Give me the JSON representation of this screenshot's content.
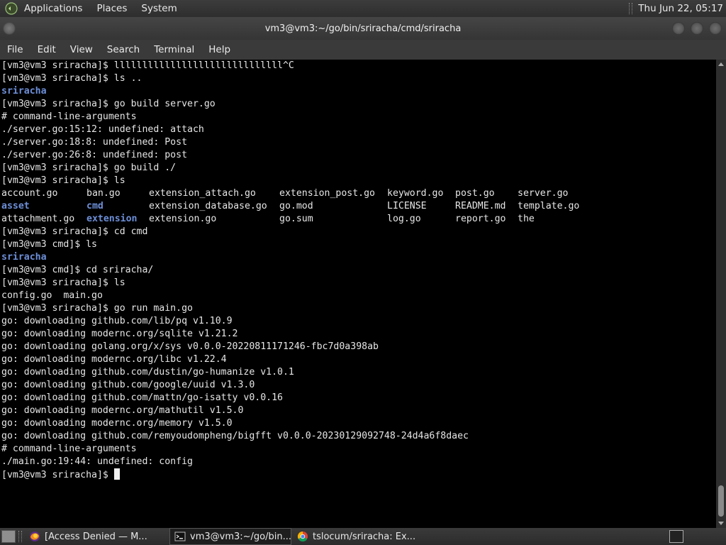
{
  "top_panel": {
    "menus": [
      "Applications",
      "Places",
      "System"
    ],
    "clock": "Thu Jun 22, 05:17"
  },
  "window": {
    "title": "vm3@vm3:~/go/bin/sriracha/cmd/sriracha"
  },
  "menubar": {
    "items": [
      "File",
      "Edit",
      "View",
      "Search",
      "Terminal",
      "Help"
    ]
  },
  "terminal": {
    "lines": [
      "[vm3@vm3 sriracha]$ llllllllllllllllllllllllllllll^C",
      "[vm3@vm3 sriracha]$ ls ..",
      "sriracha",
      "[vm3@vm3 sriracha]$ go build server.go",
      "# command-line-arguments",
      "./server.go:15:12: undefined: attach",
      "./server.go:18:8: undefined: Post",
      "./server.go:26:8: undefined: post",
      "[vm3@vm3 sriracha]$ go build ./",
      "[vm3@vm3 sriracha]$ ls"
    ],
    "ls_rows": [
      [
        "account.go",
        "ban.go",
        "extension_attach.go",
        "extension_post.go",
        "keyword.go",
        "post.go",
        "server.go"
      ],
      [
        "asset",
        "cmd",
        "extension_database.go",
        "go.mod",
        "LICENSE",
        "README.md",
        "template.go"
      ],
      [
        "attachment.go",
        "extension",
        "extension.go",
        "go.sum",
        "log.go",
        "report.go",
        "the"
      ]
    ],
    "lines2": [
      "[vm3@vm3 sriracha]$ cd cmd",
      "[vm3@vm3 cmd]$ ls",
      "sriracha",
      "[vm3@vm3 cmd]$ cd sriracha/",
      "[vm3@vm3 sriracha]$ ls",
      "config.go  main.go",
      "[vm3@vm3 sriracha]$ go run main.go",
      "go: downloading github.com/lib/pq v1.10.9",
      "go: downloading modernc.org/sqlite v1.21.2",
      "go: downloading golang.org/x/sys v0.0.0-20220811171246-fbc7d0a398ab",
      "go: downloading modernc.org/libc v1.22.4",
      "go: downloading github.com/dustin/go-humanize v1.0.1",
      "go: downloading github.com/google/uuid v1.3.0",
      "go: downloading github.com/mattn/go-isatty v0.0.16",
      "go: downloading modernc.org/mathutil v1.5.0",
      "go: downloading modernc.org/memory v1.5.0",
      "go: downloading github.com/remyoudompheng/bigfft v0.0.0-20230129092748-24d4a6f8daec",
      "# command-line-arguments",
      "./main.go:19:44: undefined: config"
    ],
    "prompt": "[vm3@vm3 sriracha]$ "
  },
  "taskbar": {
    "tasks": [
      {
        "label": "[Access Denied — M...",
        "icon": "firefox-icon",
        "active": false
      },
      {
        "label": "vm3@vm3:~/go/bin...",
        "icon": "terminal-icon",
        "active": true
      },
      {
        "label": "tslocum/sriracha: Ex...",
        "icon": "chrome-icon",
        "active": false
      }
    ]
  },
  "colors": {
    "directory": "#6d8fd8",
    "terminal_bg": "#000000",
    "terminal_fg": "#e6e6e6"
  }
}
